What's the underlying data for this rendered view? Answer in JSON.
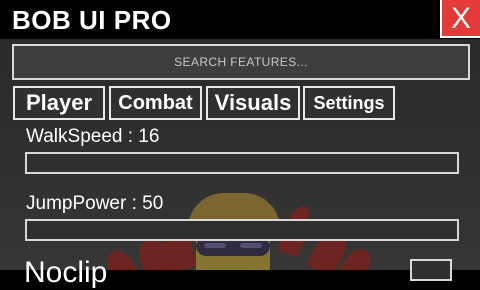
{
  "window": {
    "title": "BOB UI PRO",
    "close_label": "X"
  },
  "search": {
    "placeholder": "SEARCH FEATURES..."
  },
  "tabs": [
    {
      "label": "Player"
    },
    {
      "label": "Combat"
    },
    {
      "label": "Visuals"
    },
    {
      "label": "Settings"
    }
  ],
  "player": {
    "walkspeed_label": "WalkSpeed : 16",
    "jumppower_label": "JumpPower : 50",
    "noclip_label": "Noclip"
  },
  "colors": {
    "close_bg": "#e53a3a",
    "titlebar_bg": "#000000",
    "panel_bg": "#3a3a3a",
    "border": "#d8d8d8"
  }
}
